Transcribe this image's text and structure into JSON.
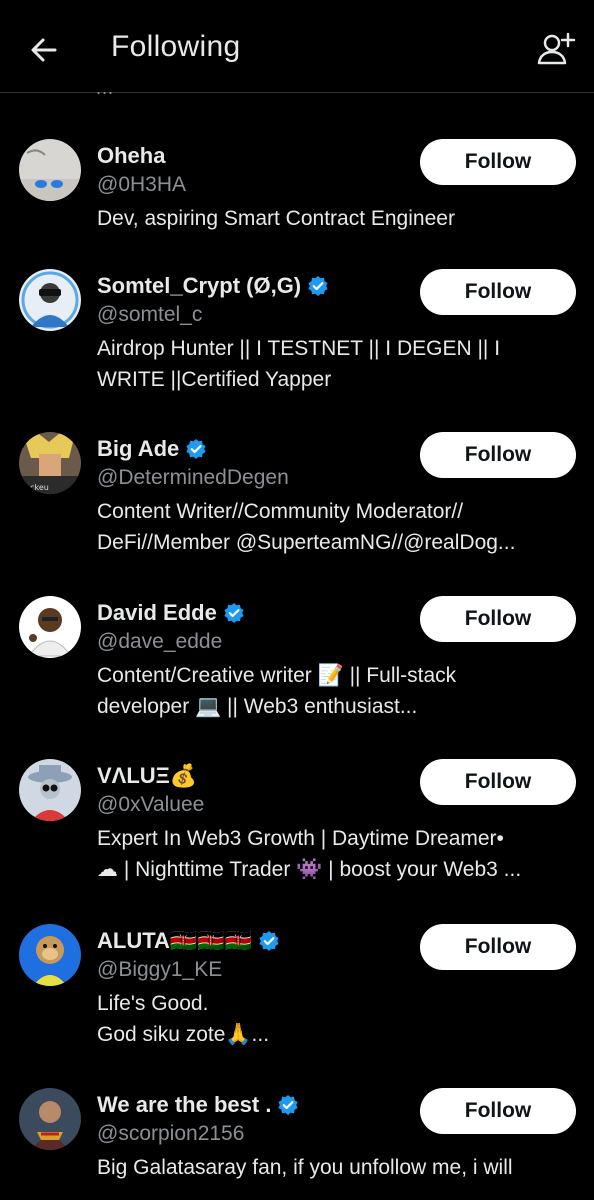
{
  "header": {
    "title": "Following",
    "back_icon": "arrow-left-icon",
    "add_icon": "person-add-icon"
  },
  "top_ellipsis": "...",
  "colors": {
    "background": "#000000",
    "primary_text": "#e7e9ea",
    "secondary_text": "#8b9095",
    "verified": "#1d9bf0",
    "button_bg": "#ffffff",
    "button_text": "#0f1419"
  },
  "users": [
    {
      "name": "Oheha",
      "handle": "@0H3HA",
      "verified": false,
      "bio": "Dev, aspiring Smart Contract Engineer",
      "button": "Follow"
    },
    {
      "name": "Somtel_Crypt (Ø,G)",
      "handle": "@somtel_c",
      "verified": true,
      "bio": "Airdrop Hunter || I TESTNET || I DEGEN || I\nWRITE ||Certified Yapper",
      "button": "Follow"
    },
    {
      "name": "Big Ade",
      "handle": "@DeterminedDegen",
      "verified": true,
      "bio": "Content Writer//Community Moderator//\nDeFi//Member @SuperteamNG//@realDog...",
      "button": "Follow"
    },
    {
      "name": "David Edde",
      "handle": "@dave_edde",
      "verified": true,
      "bio": "Content/Creative writer 📝 || Full-stack\ndeveloper 💻 || Web3 enthusiast...",
      "button": "Follow"
    },
    {
      "name": "VΛLUΞ💰",
      "handle": "@0xValuee",
      "verified": false,
      "bio": "Expert In Web3 Growth | Daytime Dreamer•\n☁ | Nighttime Trader 👾 | boost your Web3 ...",
      "button": "Follow"
    },
    {
      "name": "ALUTA🇰🇪🇰🇪🇰🇪",
      "handle": "@Biggy1_KE",
      "verified": true,
      "bio": "Life's Good.\nGod siku zote🙏...",
      "button": "Follow"
    },
    {
      "name": "We are the best .",
      "handle": "@scorpion2156",
      "verified": true,
      "bio": "Big Galatasaray fan, if you unfollow me, i will",
      "button": "Follow"
    }
  ]
}
